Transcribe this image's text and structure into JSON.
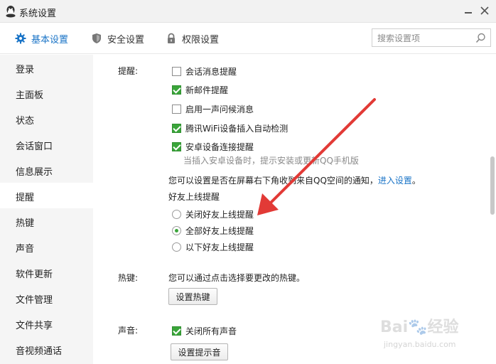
{
  "window": {
    "title": "系统设置"
  },
  "tabs": [
    {
      "label": "基本设置",
      "icon": "gear-icon",
      "active": true
    },
    {
      "label": "安全设置",
      "icon": "shield-icon",
      "active": false
    },
    {
      "label": "权限设置",
      "icon": "lock-icon",
      "active": false
    }
  ],
  "search": {
    "placeholder": "搜索设置项"
  },
  "sidebar": {
    "items": [
      {
        "label": "登录"
      },
      {
        "label": "主面板"
      },
      {
        "label": "状态"
      },
      {
        "label": "会话窗口"
      },
      {
        "label": "信息展示"
      },
      {
        "label": "提醒",
        "active": true
      },
      {
        "label": "热键"
      },
      {
        "label": "声音"
      },
      {
        "label": "软件更新"
      },
      {
        "label": "文件管理"
      },
      {
        "label": "文件共享"
      },
      {
        "label": "音视频通话"
      }
    ]
  },
  "reminder": {
    "section_label": "提醒:",
    "options": [
      {
        "label": "会话消息提醒",
        "checked": false
      },
      {
        "label": "新邮件提醒",
        "checked": true
      },
      {
        "label": "启用一声问候消息",
        "checked": false
      },
      {
        "label": "腾讯WiFi设备插入自动检测",
        "checked": true
      },
      {
        "label": "安卓设备连接提醒",
        "checked": true
      }
    ],
    "android_hint": "当插入安卓设备时，提示安装或更新QQ手机版",
    "qzone_text": "您可以设置是否在屏幕右下角收到来自QQ空间的通知，",
    "qzone_link": "进入设置",
    "qzone_suffix": "。",
    "friend_online_title": "好友上线提醒",
    "friend_online_options": [
      {
        "label": "关闭好友上线提醒",
        "selected": false
      },
      {
        "label": "全部好友上线提醒",
        "selected": true
      },
      {
        "label": "以下好友上线提醒",
        "selected": false
      }
    ]
  },
  "hotkey": {
    "section_label": "热键:",
    "description": "您可以通过点击选择要更改的热键。",
    "button_label": "设置热键"
  },
  "sound": {
    "section_label": "声音:",
    "mute_all_label": "关闭所有声音",
    "mute_all_checked": true,
    "button_label": "设置提示音"
  },
  "colors": {
    "accent": "#1a74c7",
    "check_green": "#3aa53a",
    "arrow_red": "#e23a36"
  },
  "watermark": {
    "text": "Bai 经验",
    "url_text": "jingyan.baidu.com"
  }
}
